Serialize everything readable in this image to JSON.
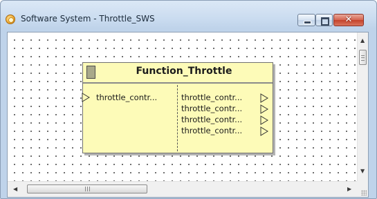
{
  "window": {
    "title": "Software System - Throttle_SWS",
    "controls": {
      "minimize": "minimize",
      "maximize": "maximize",
      "close": "close"
    }
  },
  "block": {
    "title": "Function_Throttle",
    "input_ports": [
      {
        "label": "throttle_contr..."
      }
    ],
    "output_ports": [
      {
        "label": "throttle_contr..."
      },
      {
        "label": "throttle_contr..."
      },
      {
        "label": "throttle_contr..."
      },
      {
        "label": "throttle_contr..."
      }
    ]
  },
  "scrollbars": {
    "horizontal_thumb_grip": "III"
  },
  "colors": {
    "block_fill": "#fdfbb8",
    "close_button": "#c4422a",
    "titlebar": "#c9dbef"
  }
}
